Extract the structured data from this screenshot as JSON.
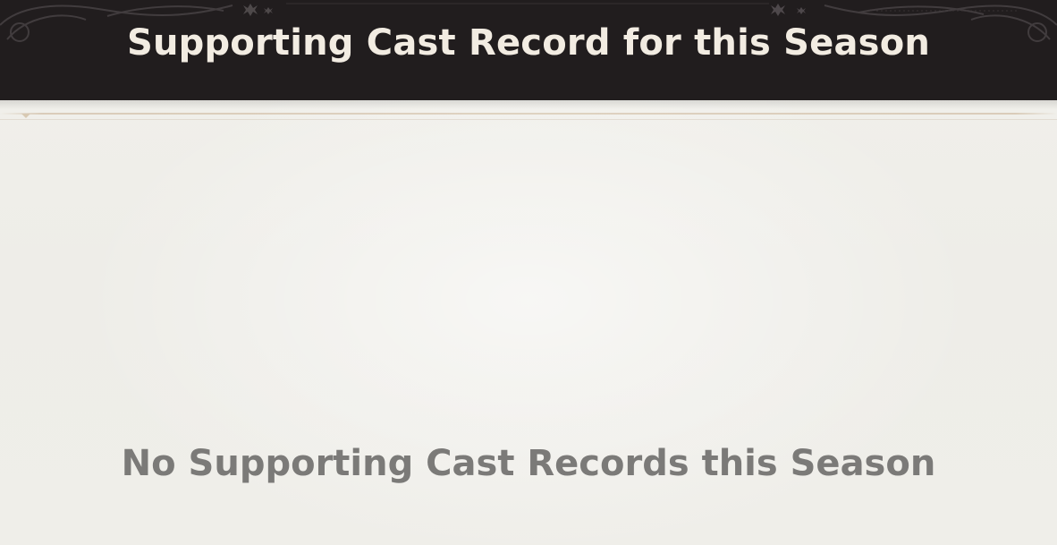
{
  "header": {
    "title": "Supporting Cast Record for this Season"
  },
  "content": {
    "empty_message": "No Supporting Cast Records this Season"
  },
  "colors": {
    "header_background": "#211d1e",
    "header_text": "#f2ece2",
    "panel_background": "#efeee9",
    "empty_text": "#7b7a78"
  }
}
